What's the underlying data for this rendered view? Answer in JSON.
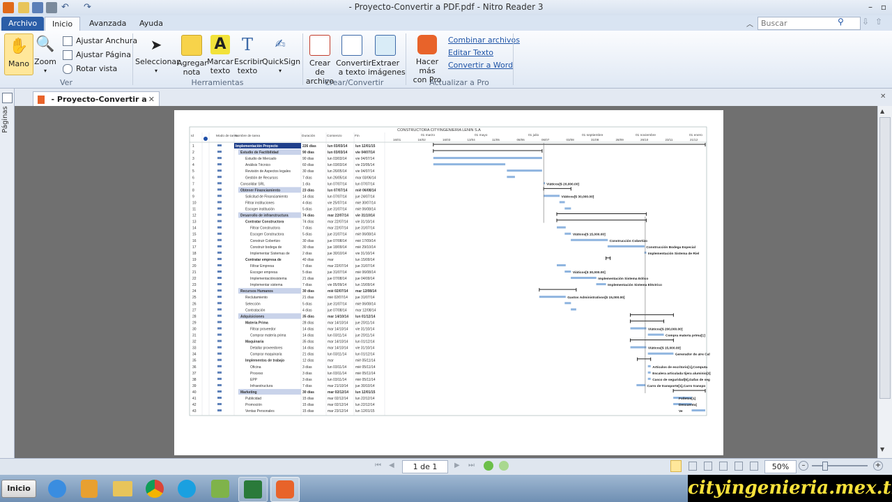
{
  "window": {
    "title": "- Proyecto-Convertir a PDF.pdf - Nitro Reader 3"
  },
  "ribbon_tabs": [
    "Archivo",
    "Inicio",
    "Avanzada",
    "Ayuda"
  ],
  "search": {
    "placeholder": "Buscar"
  },
  "ribbon": {
    "ver": {
      "label": "Ver",
      "mano": "Mano",
      "zoom": "Zoom",
      "ajustar_anchura": "Ajustar Anchura",
      "ajustar_pagina": "Ajustar Página",
      "rotar_vista": "Rotar vista"
    },
    "herramientas": {
      "label": "Herramientas",
      "seleccionar": "Seleccionar",
      "agregar_nota": [
        "Agregar",
        "nota"
      ],
      "marcar_texto": [
        "Marcar",
        "texto"
      ],
      "escribir_texto": [
        "Escribir",
        "texto"
      ],
      "quicksign": "QuickSign"
    },
    "crear": {
      "label": "Crear/Convertir",
      "crear_archivo": [
        "Crear de",
        "archivo"
      ],
      "convertir_texto": [
        "Convertir",
        "a texto"
      ],
      "extraer_imagenes": [
        "Extraer",
        "imágenes"
      ]
    },
    "pro": {
      "label": "Actualizar a Pro",
      "hacer_mas": [
        "Hacer más",
        "con Pro"
      ],
      "links": [
        "Combinar archivos",
        "Editar Texto",
        "Convertir a Word"
      ]
    }
  },
  "doc_tab": {
    "label": "- Proyecto-Convertir a PDF"
  },
  "left_panel": {
    "label": "Páginas"
  },
  "nav": {
    "page": "1 de 1",
    "zoom": "50%"
  },
  "taskbar": {
    "start": "Inicio"
  },
  "watermark": "cityingenieria.mex.tl",
  "gantt": {
    "company": "CONSTRUCTORA CITYINGENIERIA LENIN S.A",
    "headers": [
      "Id",
      "Modo de tarea",
      "Nombre de tarea",
      "Duración",
      "Comienzo",
      "Fin"
    ],
    "top_timescale": [
      "01 marzo",
      "01 mayo",
      "01 julio",
      "01 septiembre",
      "01 noviembre",
      "01 enero"
    ],
    "bottom_timescale": [
      "16/01",
      "16/02",
      "16/03",
      "13/04",
      "11/05",
      "08/06",
      "06/07",
      "03/08",
      "31/08",
      "28/09",
      "26/10",
      "23/11",
      "21/12"
    ],
    "rows": [
      {
        "id": "1",
        "name": "Implementación Proyecto",
        "dur": "226 días",
        "start": "lun 03/03/14",
        "end": "lun 12/01/15",
        "level": 0,
        "summary": true,
        "sel": true
      },
      {
        "id": "2",
        "name": "Estudio de Factibilidad",
        "dur": "90 días",
        "start": "lun 03/03/14",
        "end": "vie 04/07/14",
        "level": 1,
        "summary": true
      },
      {
        "id": "3",
        "name": "Estudio de Mercado",
        "dur": "90 días",
        "start": "lun 03/03/14",
        "end": "vie 04/07/14",
        "level": 2
      },
      {
        "id": "4",
        "name": "Análisis Técnico",
        "dur": "60 días",
        "start": "lun 03/03/14",
        "end": "vie 23/05/14",
        "level": 2
      },
      {
        "id": "5",
        "name": "Revisión de Aspectos legales",
        "dur": "30 días",
        "start": "lun 26/05/14",
        "end": "vie 04/07/14",
        "level": 2
      },
      {
        "id": "6",
        "name": "Gestión de Recursos",
        "dur": "7 días",
        "start": "lun 26/05/14",
        "end": "mar 03/06/14",
        "level": 2
      },
      {
        "id": "7",
        "name": "Consolidar SRL",
        "dur": "1 día",
        "start": "lun 07/07/14",
        "end": "lun 07/07/14",
        "level": 1
      },
      {
        "id": "8",
        "name": "Obtener Financiamiento",
        "dur": "23 días",
        "start": "lun 07/07/14",
        "end": "mié 06/08/14",
        "level": 1,
        "summary": true
      },
      {
        "id": "9",
        "name": "Solicitud de Financiamiento",
        "dur": "14 días",
        "start": "lun 07/07/14",
        "end": "jue 24/07/14",
        "level": 2
      },
      {
        "id": "10",
        "name": "Filtrar instituciones",
        "dur": "4 días",
        "start": "vie 25/07/14",
        "end": "mié 30/07/14",
        "level": 2
      },
      {
        "id": "11",
        "name": "Escoger institución",
        "dur": "5 días",
        "start": "jue 31/07/14",
        "end": "mié 06/08/14",
        "level": 2
      },
      {
        "id": "12",
        "name": "Desarrollo de infraestructura",
        "dur": "74 días",
        "start": "mar 22/07/14",
        "end": "vie 31/10/14",
        "level": 1,
        "summary": true
      },
      {
        "id": "13",
        "name": "Contratar Constructora",
        "dur": "74 días",
        "start": "mar 22/07/14",
        "end": "vie 31/10/14",
        "level": 2,
        "bold": true
      },
      {
        "id": "14",
        "name": "Filtrar Constructora",
        "dur": "7 días",
        "start": "mar 22/07/14",
        "end": "jue 31/07/14",
        "level": 3
      },
      {
        "id": "15",
        "name": "Escoger Constructora",
        "dur": "5 días",
        "start": "jue 31/07/14",
        "end": "mié 06/08/14",
        "level": 3
      },
      {
        "id": "16",
        "name": "Construir Cobertizo",
        "dur": "30 días",
        "start": "jue 07/08/14",
        "end": "mié 17/09/14",
        "level": 3
      },
      {
        "id": "17",
        "name": "Construir bodega de",
        "dur": "30 días",
        "start": "jue 18/09/14",
        "end": "mié 29/10/14",
        "level": 3
      },
      {
        "id": "18",
        "name": "Implementar Sistemas de",
        "dur": "2 días",
        "start": "jue 30/10/14",
        "end": "vie 31/10/14",
        "level": 3
      },
      {
        "id": "19",
        "name": "Contratar empresa de",
        "dur": "40 días",
        "start": "mar",
        "end": "lun 15/09/14",
        "level": 2,
        "bold": true
      },
      {
        "id": "20",
        "name": "Filtrar Empresa",
        "dur": "7 días",
        "start": "mar 22/07/14",
        "end": "jue 31/07/14",
        "level": 3
      },
      {
        "id": "21",
        "name": "Escoger empresa",
        "dur": "5 días",
        "start": "jue 31/07/14",
        "end": "mié 06/08/14",
        "level": 3
      },
      {
        "id": "22",
        "name": "Implementaciónsistema",
        "dur": "21 días",
        "start": "jue 07/08/14",
        "end": "jue 04/09/14",
        "level": 3
      },
      {
        "id": "23",
        "name": "Implementar sistema",
        "dur": "7 días",
        "start": "vie 05/09/14",
        "end": "lun 15/09/14",
        "level": 3
      },
      {
        "id": "24",
        "name": "Recursos Humanos",
        "dur": "30 días",
        "start": "mié 02/07/14",
        "end": "mar 12/08/14",
        "level": 1,
        "summary": true
      },
      {
        "id": "25",
        "name": "Reclutamiento",
        "dur": "21 días",
        "start": "mié 02/07/14",
        "end": "jue 31/07/14",
        "level": 2
      },
      {
        "id": "26",
        "name": "Selección",
        "dur": "5 días",
        "start": "jue 31/07/14",
        "end": "mié 06/08/14",
        "level": 2
      },
      {
        "id": "27",
        "name": "Contratación",
        "dur": "4 días",
        "start": "jue 07/08/14",
        "end": "mar 12/08/14",
        "level": 2
      },
      {
        "id": "28",
        "name": "Adquisiciones",
        "dur": "35 días",
        "start": "mar 14/10/14",
        "end": "lun 01/12/14",
        "level": 1,
        "summary": true
      },
      {
        "id": "29",
        "name": "Materia Prima",
        "dur": "28 días",
        "start": "mar 14/10/14",
        "end": "jue 20/11/14",
        "level": 2,
        "bold": true
      },
      {
        "id": "30",
        "name": "Filtrar proveedor",
        "dur": "14 días",
        "start": "mar 14/10/14",
        "end": "vie 31/10/14",
        "level": 3
      },
      {
        "id": "31",
        "name": "Comprar materia prima",
        "dur": "14 días",
        "start": "lun 03/11/14",
        "end": "jue 20/11/14",
        "level": 3
      },
      {
        "id": "32",
        "name": "Maquinaria",
        "dur": "35 días",
        "start": "mar 14/10/14",
        "end": "lun 01/12/14",
        "level": 2,
        "bold": true
      },
      {
        "id": "33",
        "name": "Detallar proveedores",
        "dur": "14 días",
        "start": "mar 14/10/14",
        "end": "vie 31/10/14",
        "level": 3
      },
      {
        "id": "34",
        "name": "Comprar maquinaria",
        "dur": "21 días",
        "start": "lun 03/11/14",
        "end": "lun 01/12/14",
        "level": 3
      },
      {
        "id": "35",
        "name": "Implementos de trabajo",
        "dur": "12 días",
        "start": "mar",
        "end": "mié 05/11/14",
        "level": 2,
        "bold": true
      },
      {
        "id": "36",
        "name": "Oficina",
        "dur": "3 días",
        "start": "lun 03/11/14",
        "end": "mié 05/11/14",
        "level": 3
      },
      {
        "id": "37",
        "name": "Proceso",
        "dur": "3 días",
        "start": "lun 03/11/14",
        "end": "mié 05/11/14",
        "level": 3
      },
      {
        "id": "38",
        "name": "EPP",
        "dur": "3 días",
        "start": "lun 03/11/14",
        "end": "mié 05/11/14",
        "level": 3
      },
      {
        "id": "39",
        "name": "Infraestructura",
        "dur": "7 días",
        "start": "mar 21/10/14",
        "end": "jue 30/10/14",
        "level": 3
      },
      {
        "id": "40",
        "name": "Marketing",
        "dur": "30 días",
        "start": "mar 02/12/14",
        "end": "lun 12/01/15",
        "level": 1,
        "summary": true
      },
      {
        "id": "41",
        "name": "Publicidad",
        "dur": "15 días",
        "start": "mar 02/12/14",
        "end": "lun 22/12/14",
        "level": 2
      },
      {
        "id": "42",
        "name": "Promoción",
        "dur": "15 días",
        "start": "mar 02/12/14",
        "end": "lun 22/12/14",
        "level": 2
      },
      {
        "id": "43",
        "name": "Ventas Personales",
        "dur": "15 días",
        "start": "mar 23/12/14",
        "end": "lun 12/01/15",
        "level": 2
      }
    ],
    "bar_labels": [
      "Viáticos[$ 20,000.00]",
      "Viáticos[$ 30,000.00]",
      "Viáticos[$ 15,000.00]",
      "Construcción Cobertizo",
      "Construcción Bodega Especial",
      "Implementación Sistema de Riel",
      "Viáticos[$ 30,000.00]",
      "Implementación Sistema Eólico",
      "Implementación Sistema Eléctrico",
      "Gastos Administrativos[$ 15,000.00]",
      "Viáticos[$ 200,000.00]",
      "Compra materia prima[1]",
      "Viáticos[$ 15,000.00]",
      "Generador de aire Cal",
      "Artículos de escritorio[1],Computa",
      "Escalera articulada tijera aluminio[3]",
      "Casco de seguridad[6],Gafas de seg",
      "Carro de transporte[1],Carro transpo",
      "Folletos[1]",
      "Descuento[",
      "Ve"
    ]
  }
}
